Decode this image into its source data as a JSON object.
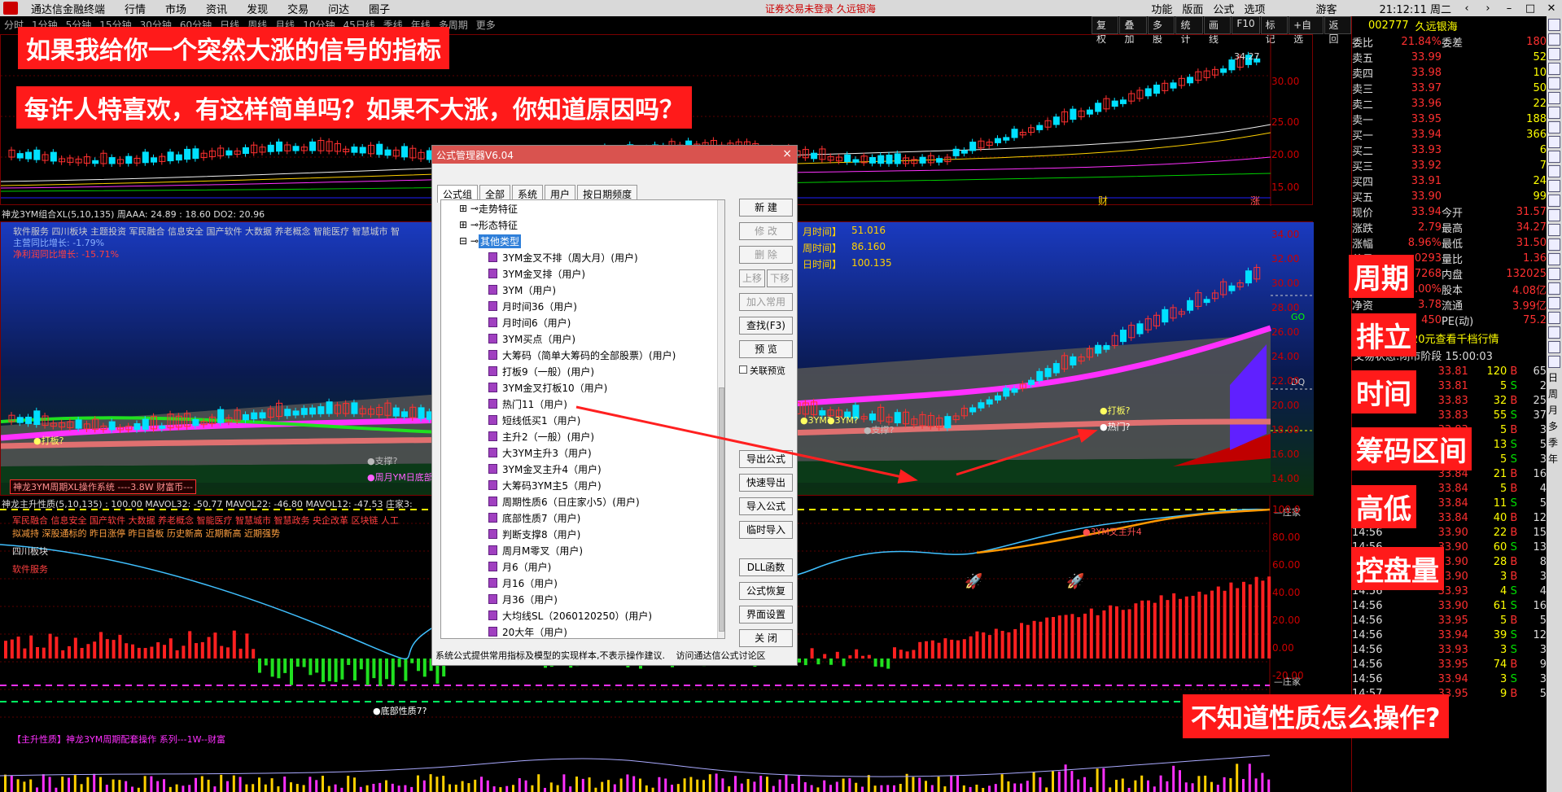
{
  "menubar": {
    "app_name": "通达信金融终端",
    "items": [
      "行情",
      "市场",
      "资讯",
      "发现",
      "交易",
      "问达",
      "圈子"
    ],
    "notice": "证券交易未登录  久远银海",
    "right_items": [
      "功能",
      "版面",
      "公式",
      "选项"
    ],
    "user": "游客",
    "clock": "21:12:11 周二"
  },
  "periodbar": {
    "items": [
      "分时",
      "1分钟",
      "5分钟",
      "15分钟",
      "30分钟",
      "60分钟",
      "日线",
      "周线",
      "月线",
      "10分钟",
      "45日线",
      "季线",
      "年线",
      "多周期",
      "更多"
    ]
  },
  "toolbar2": {
    "items": [
      "复权",
      "叠加",
      "多股",
      "统计",
      "画线",
      "F10",
      "标记",
      "+自选",
      "返回"
    ]
  },
  "banners": {
    "headline": "如果我给你一个突然大涨的信号的指标",
    "subline": "每许人特喜欢，有这样简单吗？如果不大涨，你知道原因吗？",
    "bottom": "不知道性质怎么操作?"
  },
  "right_tags": [
    "周期",
    "排立",
    "时间",
    "筹码区间",
    "高低",
    "控盘量"
  ],
  "chart_top": {
    "price_label": "34.27",
    "axis": [
      "30.00",
      "25.00",
      "20.00",
      "15.00"
    ],
    "marks": [
      "财",
      "涨"
    ]
  },
  "chart_mid": {
    "title": "神龙3YM组合XL(5,10,135) 周AAA: 24.89 : 18.60 DO2: 20.96",
    "sectors": "软件服务 四川板块 主题投资 军民融合 信息安全 国产软件 大数据 养老概念 智能医疗 智慧城市 智",
    "profit1": "主营同比增长: -1.79%",
    "profit2": "净利润同比增长: -15.71%",
    "labels": [
      "月时间】",
      "周时间】",
      "日时间】"
    ],
    "values": [
      "51.016",
      "86.160",
      "100.135"
    ],
    "axis": [
      "34.00",
      "32.00",
      "30.00",
      "28.00",
      "26.00",
      "24.00",
      "22.00",
      "20.00",
      "18.00",
      "16.00",
      "14.00"
    ],
    "annotations": [
      "●打板?",
      "●3YM?",
      "●3YM?",
      "●支撑?",
      "●打板?",
      "●热门?",
      "●支撑?",
      "GO",
      "DQ"
    ],
    "footer": "神龙3YM周期XL操作系统 ----3.8W 财富币---",
    "week_bottom": "●周月YM日底部"
  },
  "chart_low": {
    "title": "神龙主升性质(5,10,135) : 100.00 MAVOL32: -50.77 MAVOL22: -46.80 MAVOL12: -47.53 庄家3:",
    "sectors": "军民融合 信息安全 国产软件 大数据 养老概念 智能医疗 智慧城市 智慧政务 央企改革 区块链 人工",
    "line2": "拟减持 深股通标的 昨日涨停 昨日首板 历史新高 近期新高 近期强势",
    "tag1": "四川板块",
    "tag2": "软件服务",
    "annotations": [
      "●3YM叉主升4",
      "●底部性质7?",
      "—庄家",
      "—庄家"
    ],
    "axis": [
      "100.0",
      "80.00",
      "60.00",
      "40.00",
      "20.00",
      "0.00",
      "-20.00",
      "-40.00"
    ]
  },
  "chart_bot": {
    "title": "【主升性质】神龙3YM周期配套操作 系列---1W--财富"
  },
  "quote": {
    "code": "002777",
    "name": "久远银海",
    "webi_label": "委比",
    "webi_value": "21.84%",
    "weicha_label": "委差",
    "weicha_value": "180",
    "sell": [
      {
        "label": "卖五",
        "price": "33.99",
        "vol": "52"
      },
      {
        "label": "卖四",
        "price": "33.98",
        "vol": "10"
      },
      {
        "label": "卖三",
        "price": "33.97",
        "vol": "50"
      },
      {
        "label": "卖二",
        "price": "33.96",
        "vol": "22"
      },
      {
        "label": "卖一",
        "price": "33.95",
        "vol": "188"
      }
    ],
    "buy": [
      {
        "label": "买一",
        "price": "33.94",
        "vol": "366"
      },
      {
        "label": "买二",
        "price": "33.93",
        "vol": "6"
      },
      {
        "label": "买三",
        "price": "33.92",
        "vol": "7"
      },
      {
        "label": "买四",
        "price": "33.91",
        "vol": "24"
      },
      {
        "label": "买五",
        "price": "33.90",
        "vol": "99"
      }
    ],
    "stats": [
      {
        "l1": "现价",
        "v1": "33.94",
        "l2": "今开",
        "v2": "31.57"
      },
      {
        "l1": "涨跌",
        "v1": "2.79",
        "l2": "最高",
        "v2": "34.27"
      },
      {
        "l1": "涨幅",
        "v1": "8.96%",
        "l2": "最低",
        "v2": "31.50"
      },
      {
        "l1": "总量",
        "v1": "0293",
        "l2": "量比",
        "v2": "1.36"
      },
      {
        "l1": "外盘",
        "v1": "7268",
        "l2": "内盘",
        "v2": "132025"
      },
      {
        "l1": "换手",
        "v1": "7.00%",
        "l2": "股本",
        "v2": "4.08亿"
      },
      {
        "l1": "净资",
        "v1": "3.78",
        "l2": "流通",
        "v2": "3.99亿"
      },
      {
        "l1": "收益",
        "v1": "450",
        "l2": "PE(动)",
        "v2": "75.2"
      }
    ],
    "promo": "首20元查看千档行情",
    "status": "交易状态:闭市阶段 15:00:03",
    "ticks": [
      {
        "t": "",
        "p": "33.81",
        "v": "120",
        "s": "B",
        "n": "65"
      },
      {
        "t": "",
        "p": "33.81",
        "v": "5",
        "s": "S",
        "n": "2"
      },
      {
        "t": "",
        "p": "33.83",
        "v": "32",
        "s": "B",
        "n": "25"
      },
      {
        "t": "",
        "p": "33.83",
        "v": "55",
        "s": "S",
        "n": "37"
      },
      {
        "t": "",
        "p": "33.83",
        "v": "5",
        "s": "B",
        "n": "3"
      },
      {
        "t": "",
        "p": "33.83",
        "v": "13",
        "s": "S",
        "n": "5"
      },
      {
        "t": "",
        "p": "33.84",
        "v": "5",
        "s": "S",
        "n": "3"
      },
      {
        "t": "",
        "p": "33.84",
        "v": "21",
        "s": "B",
        "n": "16"
      },
      {
        "t": "",
        "p": "33.84",
        "v": "5",
        "s": "B",
        "n": "4"
      },
      {
        "t": "",
        "p": "33.84",
        "v": "11",
        "s": "S",
        "n": "5"
      },
      {
        "t": "",
        "p": "33.84",
        "v": "40",
        "s": "B",
        "n": "12"
      },
      {
        "t": "14:56",
        "p": "33.90",
        "v": "22",
        "s": "B",
        "n": "15"
      },
      {
        "t": "14:56",
        "p": "33.90",
        "v": "60",
        "s": "S",
        "n": "13"
      },
      {
        "t": "14:56",
        "p": "33.90",
        "v": "28",
        "s": "B",
        "n": "8"
      },
      {
        "t": "14:56",
        "p": "33.90",
        "v": "3",
        "s": "B",
        "n": "3"
      },
      {
        "t": "14:56",
        "p": "33.93",
        "v": "4",
        "s": "S",
        "n": "4"
      },
      {
        "t": "14:56",
        "p": "33.90",
        "v": "61",
        "s": "S",
        "n": "16"
      },
      {
        "t": "14:56",
        "p": "33.95",
        "v": "5",
        "s": "B",
        "n": "5"
      },
      {
        "t": "14:56",
        "p": "33.94",
        "v": "39",
        "s": "S",
        "n": "12"
      },
      {
        "t": "14:56",
        "p": "33.93",
        "v": "3",
        "s": "S",
        "n": "3"
      },
      {
        "t": "14:56",
        "p": "33.95",
        "v": "74",
        "s": "B",
        "n": "9"
      },
      {
        "t": "14:56",
        "p": "33.94",
        "v": "3",
        "s": "S",
        "n": "3"
      },
      {
        "t": "14:57",
        "p": "33.95",
        "v": "9",
        "s": "B",
        "n": "5"
      }
    ],
    "side_labels": [
      "日",
      "周",
      "月",
      "多",
      "季",
      "年"
    ]
  },
  "dialog": {
    "title": "公式管理器V6.04",
    "tabs": [
      "公式组",
      "全部",
      "系统",
      "用户",
      "按日期频度"
    ],
    "groups": [
      "走势特征",
      "形态特征",
      "其他类型"
    ],
    "items": [
      "3YM金叉不排（周大月）(用户)",
      "3YM金叉排（用户)",
      "3YM（用户)",
      "月时间36（用户)",
      "月时间6（用户)",
      "3YM买点（用户)",
      "大筹码（简单大筹码的全部股票）(用户)",
      "打板9（一般）(用户)",
      "3YM金叉打板10（用户)",
      "热门11（用户)",
      "短线低买1（用户)",
      "主升2（一般）(用户)",
      "大3YM主升3（用户)",
      "3YM金叉主升4（用户)",
      "大筹码3YM主5（用户)",
      "周期性质6（日庄家小5）(用户)",
      "底部性质7（用户)",
      "判断支撑8（用户)",
      "周月M零叉（用户)",
      "月6（用户)",
      "月16（用户)",
      "月36（用户)",
      "大均线SL（2060120250）(用户)",
      "20大年（用户)"
    ],
    "buttons": [
      "新 建",
      "修 改",
      "删 除",
      "上移",
      "下移",
      "加入常用",
      "查找(F3)",
      "预 览"
    ],
    "preview_label": "关联预览",
    "buttons2": [
      "导出公式",
      "快速导出",
      "导入公式",
      "临时导入",
      "DLL函数",
      "公式恢复",
      "界面设置",
      "关 闭"
    ],
    "footer": "系统公式提供常用指标及模型的实现样本,不表示操作建议.",
    "footer_link": "访问通达信公式讨论区",
    "close": "×"
  },
  "colors": {
    "banner_red": "#ff1a1a",
    "chart_border": "#7a0000",
    "magenta": "#ff30ff",
    "candle_up": "#ff3030",
    "candle_down": "#00e0ff"
  }
}
